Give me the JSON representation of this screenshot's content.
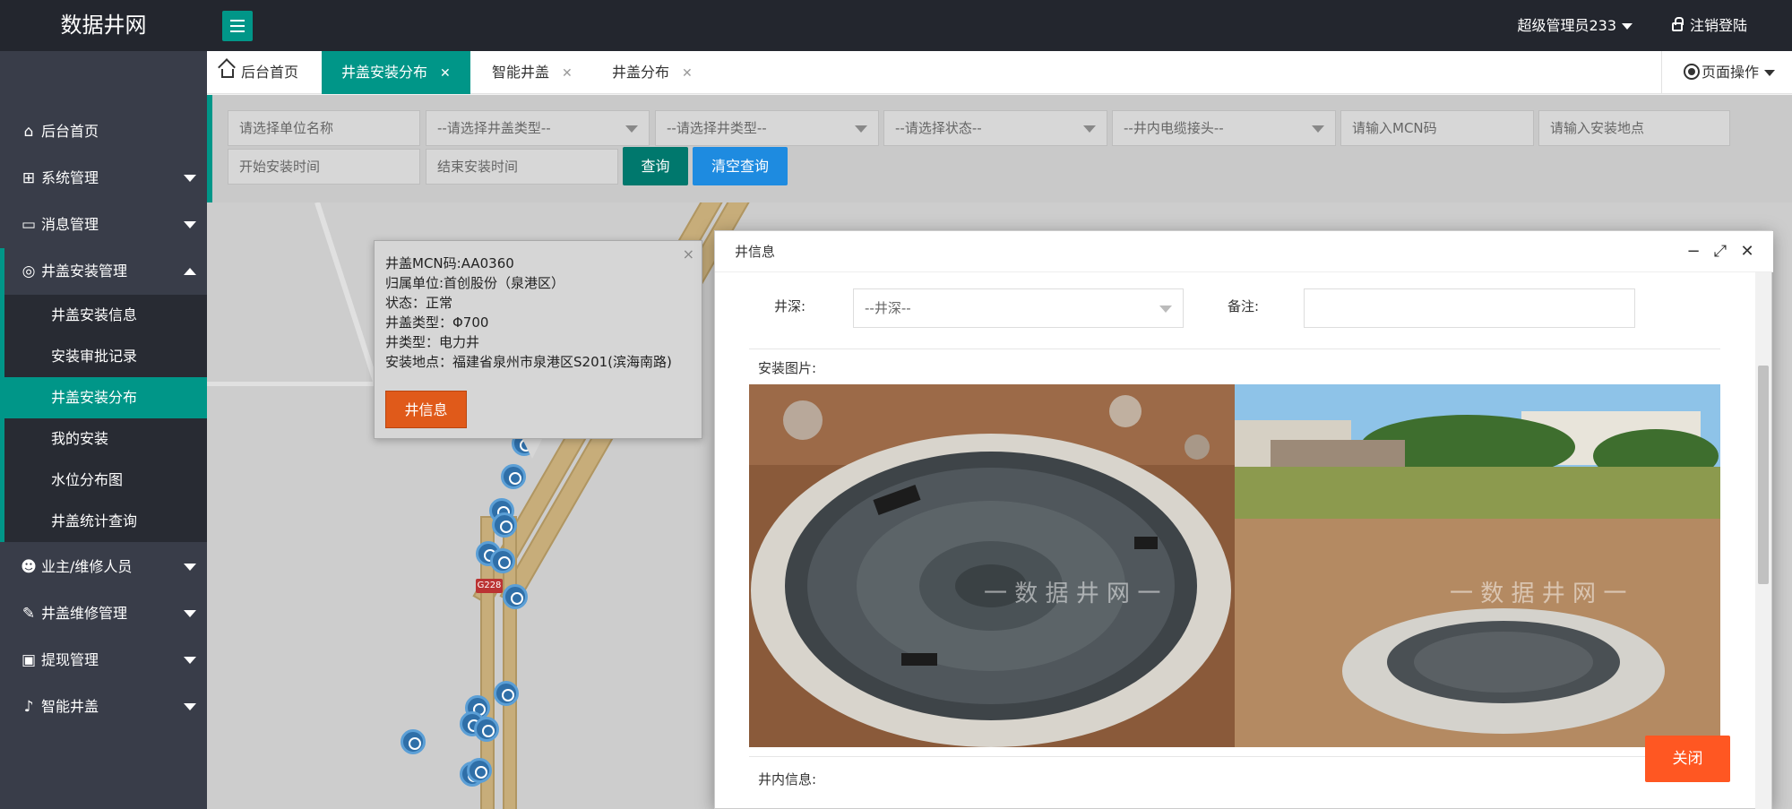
{
  "header": {
    "brand": "数据井网",
    "user": "超级管理员233",
    "logout": "注销登陆"
  },
  "sidebar": {
    "items": [
      {
        "label": "后台首页",
        "icon": "home-icon"
      },
      {
        "label": "系统管理",
        "icon": "grid-icon"
      },
      {
        "label": "消息管理",
        "icon": "message-icon"
      },
      {
        "label": "井盖安装管理",
        "icon": "target-icon"
      },
      {
        "label": "业主/维修人员",
        "icon": "users-icon"
      },
      {
        "label": "井盖维修管理",
        "icon": "edit-icon"
      },
      {
        "label": "提现管理",
        "icon": "withdraw-icon"
      },
      {
        "label": "智能井盖",
        "icon": "bell-icon"
      }
    ],
    "sub_items": [
      "井盖安装信息",
      "安装审批记录",
      "井盖安装分布",
      "我的安装",
      "水位分布图",
      "井盖统计查询"
    ]
  },
  "tabs": {
    "home": "后台首页",
    "items": [
      "井盖安装分布",
      "智能井盖",
      "井盖分布"
    ],
    "page_ops": "页面操作"
  },
  "filters": {
    "unit_placeholder": "请选择单位名称",
    "cover_type": "--请选择井盖类型--",
    "well_type": "--请选择井类型--",
    "status": "--请选择状态--",
    "cable": "--井内电缆接头--",
    "mcn_placeholder": "请输入MCN码",
    "location_placeholder": "请输入安装地点",
    "start_time_placeholder": "开始安装时间",
    "end_time_placeholder": "结束安装时间",
    "query_btn": "查询",
    "clear_btn": "清空查询"
  },
  "map": {
    "road_sign": "G228",
    "popup": {
      "mcn": "井盖MCN码:AA0360",
      "unit": "归属单位:首创股份（泉港区）",
      "status": "状态：正常",
      "cover_type": "井盖类型：Φ700",
      "well_type": "井类型：电力井",
      "location": "安装地点：福建省泉州市泉港区S201(滨海南路)",
      "button": "井信息",
      "close": "×"
    }
  },
  "dialog": {
    "title": "井信息",
    "depth_label": "井深:",
    "depth_value": "--井深--",
    "remark_label": "备注:",
    "photos_label": "安装图片:",
    "watermark": "一 数 据 井 网 一",
    "inner_label": "井内信息:",
    "close_btn": "关闭"
  },
  "colors": {
    "accent": "#009688",
    "sidebar": "#393d49",
    "topbar": "#23262e",
    "query": "#009688",
    "clear": "#1e9fff",
    "danger": "#ff5722"
  }
}
